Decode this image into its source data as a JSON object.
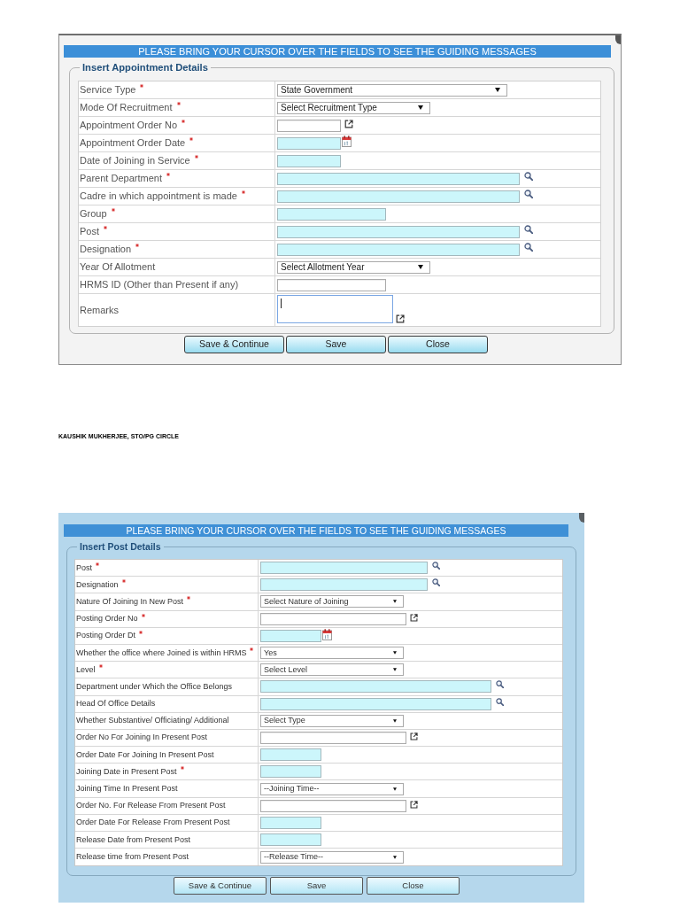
{
  "appointment_form": {
    "banner": "PLEASE BRING YOUR CURSOR OVER THE FIELDS TO SEE THE GUIDING MESSAGES",
    "legend": "Insert Appointment Details",
    "fields": [
      {
        "label": "Service Type",
        "required": true,
        "kind": "select",
        "value": "State Government",
        "focused": false
      },
      {
        "label": "Mode Of Recruitment",
        "required": true,
        "kind": "select",
        "value": "Select Recruitment Type",
        "focused": false
      },
      {
        "label": "Appointment Order No",
        "required": true,
        "kind": "linked_text",
        "focused": false
      },
      {
        "label": "Appointment Order Date",
        "required": true,
        "kind": "date",
        "focused": false
      },
      {
        "label": "Date of Joining in Service",
        "required": true,
        "kind": "shaded",
        "focused": false
      },
      {
        "label": "Parent Department",
        "required": true,
        "kind": "lookup",
        "focused": false
      },
      {
        "label": "Cadre in which appointment is made",
        "required": true,
        "kind": "lookup",
        "focused": false
      },
      {
        "label": "Group",
        "required": true,
        "kind": "shaded",
        "focused": false
      },
      {
        "label": "Post",
        "required": true,
        "kind": "lookup",
        "focused": false
      },
      {
        "label": "Designation",
        "required": true,
        "kind": "lookup",
        "focused": false
      },
      {
        "label": "Year Of Allotment",
        "required": false,
        "kind": "select",
        "value": "Select Allotment Year",
        "focused": false
      },
      {
        "label": "HRMS ID (Other than Present if any)",
        "required": false,
        "kind": "text",
        "focused": false
      },
      {
        "label": "Remarks",
        "required": false,
        "kind": "textarea",
        "focused": true
      }
    ],
    "buttons": [
      "Save & Continue",
      "Save",
      "Close"
    ]
  },
  "caption": "KAUSHIK MUKHERJEE, STO/PG CIRCLE",
  "post_form": {
    "banner": "PLEASE BRING YOUR CURSOR OVER THE FIELDS TO SEE THE GUIDING MESSAGES",
    "legend": "Insert Post Details",
    "fields": [
      {
        "label": "Post",
        "required": true,
        "kind": "lookup"
      },
      {
        "label": "Designation",
        "required": true,
        "kind": "lookup"
      },
      {
        "label": "Nature Of Joining In New Post",
        "required": true,
        "kind": "select",
        "value": "Select Nature of Joining"
      },
      {
        "label": "Posting Order No",
        "required": true,
        "kind": "linked_text"
      },
      {
        "label": "Posting Order Dt",
        "required": true,
        "kind": "date"
      },
      {
        "label": "Whether the office where Joined is within HRMS",
        "required": true,
        "kind": "select",
        "value": "Yes"
      },
      {
        "label": "Level",
        "required": true,
        "kind": "select",
        "value": "Select Level"
      },
      {
        "label": "Department under Which the Office Belongs",
        "required": false,
        "kind": "lookup"
      },
      {
        "label": "Head Of Office Details",
        "required": false,
        "kind": "lookup"
      },
      {
        "label": "Whether Substantive/ Officiating/ Additional",
        "required": false,
        "kind": "select",
        "value": "Select Type"
      },
      {
        "label": "Order No For Joining In Present Post",
        "required": false,
        "kind": "linked_text"
      },
      {
        "label": "Order Date For Joining In Present Post",
        "required": false,
        "kind": "shaded"
      },
      {
        "label": "Joining Date in Present Post",
        "required": true,
        "kind": "shaded"
      },
      {
        "label": "Joining Time In Present Post",
        "required": false,
        "kind": "select",
        "value": "--Joining Time--"
      },
      {
        "label": "Order No. For Release From Present Post",
        "required": false,
        "kind": "linked_text"
      },
      {
        "label": "Order Date For Release From Present Post",
        "required": false,
        "kind": "shaded"
      },
      {
        "label": "Release Date from Present Post",
        "required": false,
        "kind": "shaded"
      },
      {
        "label": "Release time from Present Post",
        "required": false,
        "kind": "select",
        "value": "--Release Time--"
      }
    ],
    "buttons": [
      "Save & Continue",
      "Save",
      "Close"
    ]
  }
}
